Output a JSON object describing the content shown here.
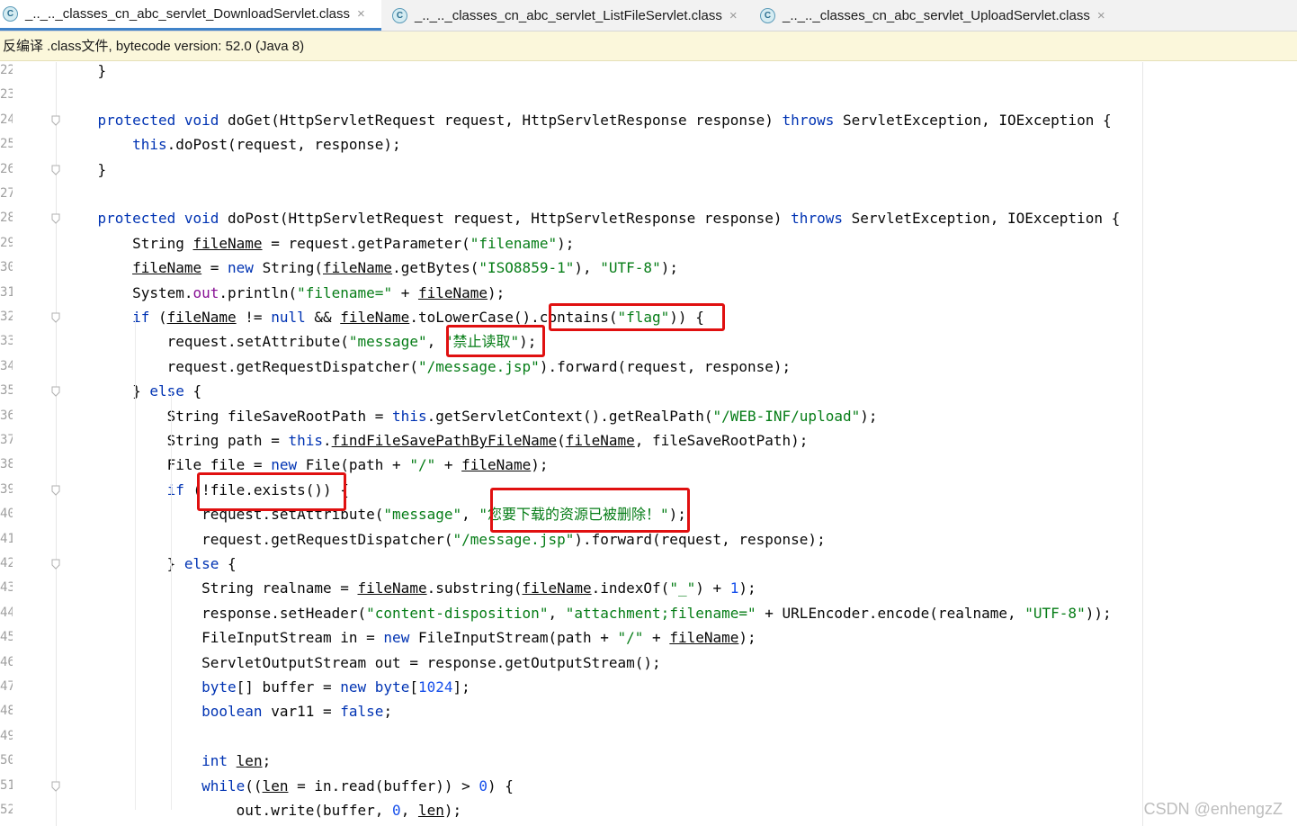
{
  "tabs": [
    {
      "label": "_.._.._classes_cn_abc_servlet_DownloadServlet.class",
      "active": true
    },
    {
      "label": "_.._.._classes_cn_abc_servlet_ListFileServlet.class",
      "active": false
    },
    {
      "label": "_.._.._classes_cn_abc_servlet_UploadServlet.class",
      "active": false
    }
  ],
  "banner": "反编译 .class文件, bytecode version: 52.0 (Java 8)",
  "code_lines": [
    {
      "n": "22",
      "t": "    }"
    },
    {
      "n": "23",
      "t": ""
    },
    {
      "n": "24",
      "t": "    protected void doGet(HttpServletRequest request, HttpServletResponse response) throws ServletException, IOException {"
    },
    {
      "n": "25",
      "t": "        this.doPost(request, response);"
    },
    {
      "n": "26",
      "t": "    }"
    },
    {
      "n": "27",
      "t": ""
    },
    {
      "n": "28",
      "t": "    protected void doPost(HttpServletRequest request, HttpServletResponse response) throws ServletException, IOException {"
    },
    {
      "n": "29",
      "t": "        String fileName = request.getParameter(\"filename\");"
    },
    {
      "n": "30",
      "t": "        fileName = new String(fileName.getBytes(\"ISO8859-1\"), \"UTF-8\");"
    },
    {
      "n": "31",
      "t": "        System.out.println(\"filename=\" + fileName);"
    },
    {
      "n": "32",
      "t": "        if (fileName != null && fileName.toLowerCase().contains(\"flag\")) {"
    },
    {
      "n": "33",
      "t": "            request.setAttribute(\"message\", \"禁止读取\");"
    },
    {
      "n": "34",
      "t": "            request.getRequestDispatcher(\"/message.jsp\").forward(request, response);"
    },
    {
      "n": "35",
      "t": "        } else {"
    },
    {
      "n": "36",
      "t": "            String fileSaveRootPath = this.getServletContext().getRealPath(\"/WEB-INF/upload\");"
    },
    {
      "n": "37",
      "t": "            String path = this.findFileSavePathByFileName(fileName, fileSaveRootPath);"
    },
    {
      "n": "38",
      "t": "            File file = new File(path + \"/\" + fileName);"
    },
    {
      "n": "39",
      "t": "            if (!file.exists()) {"
    },
    {
      "n": "40",
      "t": "                request.setAttribute(\"message\", \"您要下载的资源已被删除！\");"
    },
    {
      "n": "41",
      "t": "                request.getRequestDispatcher(\"/message.jsp\").forward(request, response);"
    },
    {
      "n": "42",
      "t": "            } else {"
    },
    {
      "n": "43",
      "t": "                String realname = fileName.substring(fileName.indexOf(\"_\") + 1);"
    },
    {
      "n": "44",
      "t": "                response.setHeader(\"content-disposition\", \"attachment;filename=\" + URLEncoder.encode(realname, \"UTF-8\"));"
    },
    {
      "n": "45",
      "t": "                FileInputStream in = new FileInputStream(path + \"/\" + fileName);"
    },
    {
      "n": "46",
      "t": "                ServletOutputStream out = response.getOutputStream();"
    },
    {
      "n": "47",
      "t": "                byte[] buffer = new byte[1024];"
    },
    {
      "n": "48",
      "t": "                boolean var11 = false;"
    },
    {
      "n": "49",
      "t": ""
    },
    {
      "n": "50",
      "t": "                int len;"
    },
    {
      "n": "51",
      "t": "                while((len = in.read(buffer)) > 0) {"
    },
    {
      "n": "52",
      "t": "                    out.write(buffer, 0, len);"
    }
  ],
  "watermark": "CSDN @enhengzZ",
  "colors": {
    "keyword": "#0033b3",
    "string": "#067d17",
    "number": "#1750eb",
    "field": "#871094",
    "highlight_box": "#e01010",
    "banner_bg": "#fbf7db"
  }
}
